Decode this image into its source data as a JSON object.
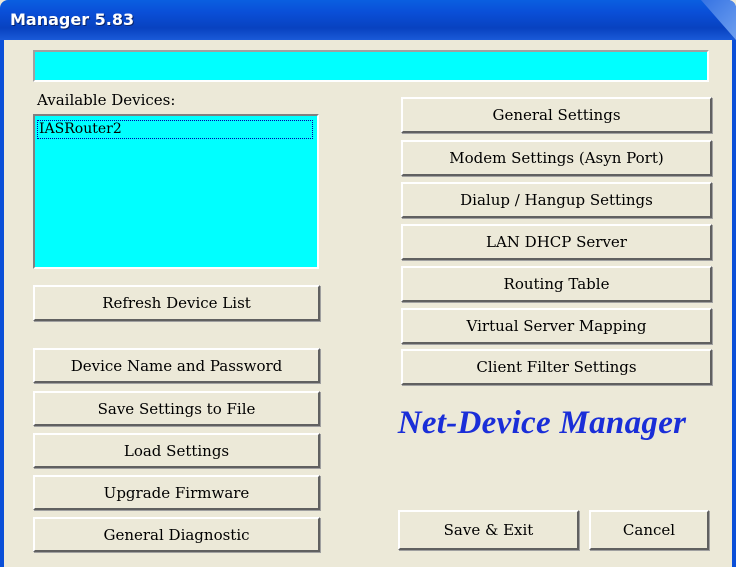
{
  "window": {
    "title": "Manager 5.83"
  },
  "status": {
    "text": ""
  },
  "devices": {
    "label": "Available Devices:",
    "items": [
      "IASRouter2"
    ]
  },
  "left_buttons": {
    "refresh": "Refresh Device List",
    "device_name": "Device Name and Password",
    "save_file": "Save Settings to File",
    "load": "Load Settings",
    "upgrade": "Upgrade Firmware",
    "diagnostic": "General Diagnostic"
  },
  "right_buttons": {
    "general": "General Settings",
    "modem": "Modem Settings (Asyn Port)",
    "dialup": "Dialup / Hangup Settings",
    "lan_dhcp": "LAN DHCP Server",
    "routing": "Routing Table",
    "virtual_server": "Virtual Server Mapping",
    "client_filter": "Client Filter Settings"
  },
  "branding": {
    "text": "Net-Device Manager",
    "color": "#1a2ed8"
  },
  "footer": {
    "save_exit": "Save & Exit",
    "cancel": "Cancel"
  },
  "colors": {
    "field_background": "#00ffff",
    "window_background": "#ece9d8",
    "titlebar": "#0a4fd8"
  }
}
